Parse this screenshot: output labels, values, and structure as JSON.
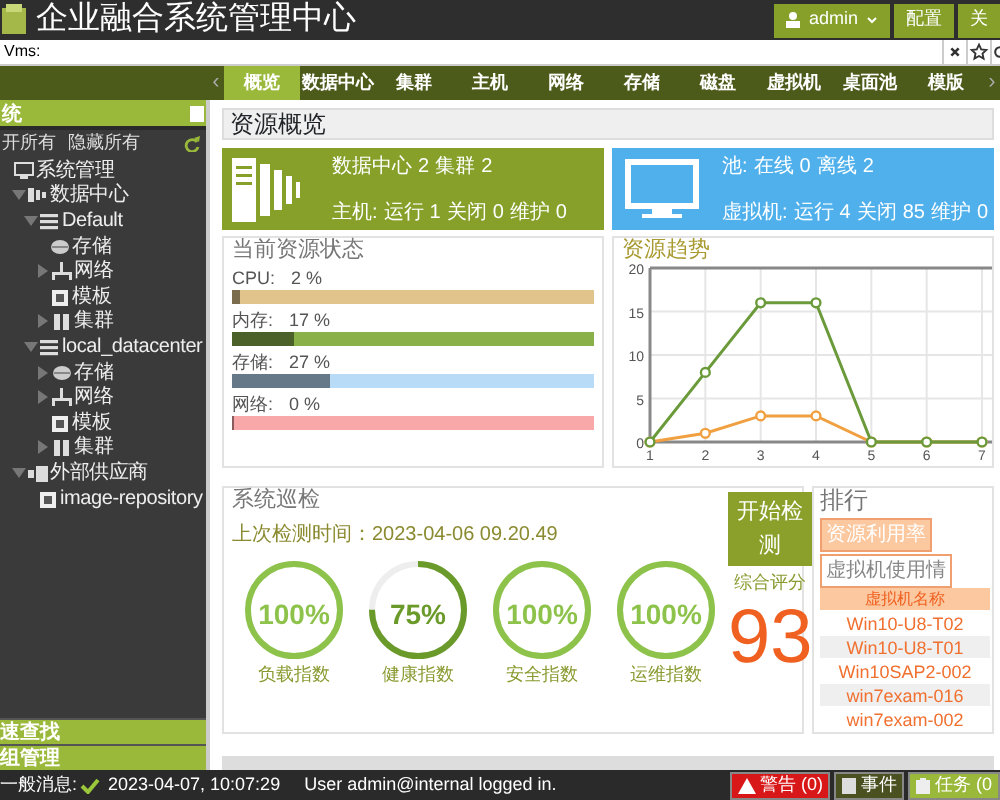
{
  "header": {
    "title": "企业融合系统管理中心",
    "user": "admin",
    "buttons": [
      "配置",
      "关"
    ]
  },
  "search": {
    "value": "Vms:"
  },
  "nav": {
    "prev": "‹",
    "next": "›",
    "tabs": [
      {
        "label": "概览",
        "selected": true
      },
      {
        "label": "数据中心",
        "selected": false
      },
      {
        "label": "集群",
        "selected": false
      },
      {
        "label": "主机",
        "selected": false
      },
      {
        "label": "网络",
        "selected": false
      },
      {
        "label": "存储",
        "selected": false
      },
      {
        "label": "磁盘",
        "selected": false
      },
      {
        "label": "虚拟机",
        "selected": false
      },
      {
        "label": "桌面池",
        "selected": false
      },
      {
        "label": "模版",
        "selected": false
      }
    ]
  },
  "sidebar": {
    "title": "统",
    "actions": [
      "开所有",
      "隐藏所有"
    ],
    "tree": [
      {
        "label": "系统管理",
        "kind": "monitor",
        "children": [
          {
            "label": "数据中心",
            "kind": "datacenter",
            "expanded": true,
            "children": [
              {
                "label": "Default",
                "kind": "list",
                "expanded": true,
                "children": [
                  {
                    "label": "存储",
                    "kind": "storage"
                  },
                  {
                    "label": "网络",
                    "kind": "network",
                    "expanded": false
                  },
                  {
                    "label": "模板",
                    "kind": "template"
                  },
                  {
                    "label": "集群",
                    "kind": "cluster",
                    "expanded": false
                  }
                ]
              },
              {
                "label": "local_datacenter",
                "kind": "list",
                "expanded": true,
                "children": [
                  {
                    "label": "存储",
                    "kind": "storage",
                    "expanded": false
                  },
                  {
                    "label": "网络",
                    "kind": "network",
                    "expanded": false
                  },
                  {
                    "label": "模板",
                    "kind": "template"
                  },
                  {
                    "label": "集群",
                    "kind": "cluster",
                    "expanded": false
                  }
                ]
              }
            ]
          },
          {
            "label": "外部供应商",
            "kind": "vendor",
            "expanded": true,
            "children": [
              {
                "label": "image-repository",
                "kind": "image"
              }
            ]
          }
        ]
      }
    ],
    "footer_sections": [
      "速查找",
      "组管理"
    ]
  },
  "main": {
    "title": "资源概览",
    "cards": [
      {
        "kind": "server",
        "color": "#86a02a",
        "lines": [
          [
            "数据中心",
            "2",
            "集群",
            "2"
          ],
          [
            "主机:",
            "运行",
            "1",
            "关闭",
            "0",
            "维护",
            "0"
          ]
        ]
      },
      {
        "kind": "monitor",
        "color": "#4fb0ec",
        "lines": [
          [
            "池:",
            "在线",
            "0",
            "离线",
            "2"
          ],
          [
            "虚拟机:",
            "运行",
            "4",
            "关闭",
            "85",
            "维护",
            "0"
          ]
        ]
      }
    ],
    "status": {
      "title": "当前资源状态",
      "bars": [
        {
          "label": "CPU:",
          "reading": "2 %",
          "level": 0.02,
          "color": "#e0c48c"
        },
        {
          "label": "内存:",
          "reading": "17 %",
          "level": 0.17,
          "color": "#8ab04a"
        },
        {
          "label": "存储:",
          "reading": "27 %",
          "level": 0.27,
          "color": "#b8dcf8"
        },
        {
          "label": "网络:",
          "reading": "0 %",
          "level": 0,
          "color": "#f8a8a8"
        }
      ]
    },
    "trend": {
      "title": "资源趋势",
      "chart_data": {
        "type": "line",
        "grid": true,
        "categories": [
          "1",
          "2",
          "3",
          "4",
          "5",
          "6",
          "7"
        ],
        "series": [
          {
            "color": "#6a9a3a",
            "marker": true,
            "values": [
              0,
              8,
              16,
              16,
              0,
              0,
              0
            ]
          },
          {
            "color": "#f0a040",
            "marker": true,
            "values": [
              0,
              1,
              3,
              3,
              0,
              0,
              0
            ]
          }
        ],
        "ylim": [
          0,
          20
        ],
        "yticks": [
          0,
          5,
          10,
          15,
          20
        ]
      }
    },
    "inspection": {
      "title": "系统巡检",
      "last_check": "上次检测时间：2023-04-06 09.20.49",
      "gauges": [
        {
          "value": "100%",
          "label": "负载指数",
          "level": 1
        },
        {
          "value": "75%",
          "label": "健康指数",
          "level": 0.75
        },
        {
          "value": "100%",
          "label": "安全指数",
          "level": 1
        },
        {
          "value": "100%",
          "label": "运维指数",
          "level": 1
        }
      ],
      "button": "开始检测",
      "score_label": "综合评分",
      "score": "93"
    },
    "ranking": {
      "title": "排行",
      "tabs": [
        {
          "label": "资源利用率",
          "selected": true
        },
        {
          "label": "虚拟机使用情",
          "selected": false
        }
      ],
      "column": "虚拟机名称",
      "rows": [
        "Win10-U8-T02",
        "Win10-U8-T01",
        "Win10SAP2-002",
        "win7exam-016",
        "win7exam-002"
      ]
    }
  },
  "status_bar": {
    "label": "一般消息:",
    "time": "2023-04-07, 10:07:29",
    "message": "User admin@internal logged in.",
    "buttons": [
      {
        "kind": "alert",
        "label": "警告 (0)"
      },
      {
        "kind": "event",
        "label": "事件"
      },
      {
        "kind": "task",
        "label": "任务 (0"
      }
    ]
  }
}
